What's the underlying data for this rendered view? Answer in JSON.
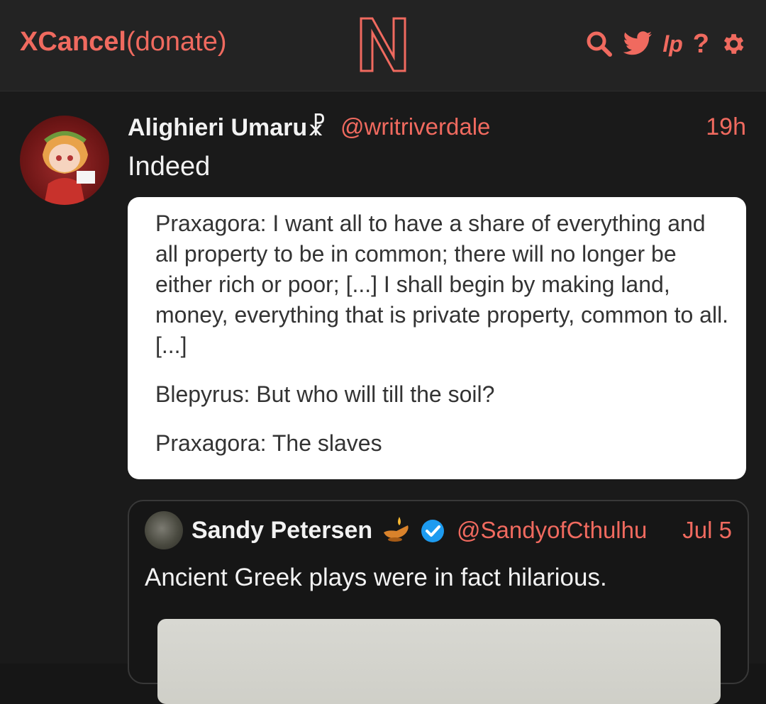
{
  "header": {
    "brand_bold": "XCancel",
    "brand_link": "(donate)",
    "accent_color": "#f06a5f",
    "logo_icon": "n-logo-icon",
    "icons": [
      "search-icon",
      "twitter-bird-icon",
      "liberapay-icon",
      "help-icon",
      "gear-icon"
    ],
    "lp_label": "lp",
    "help_label": "?"
  },
  "tweet": {
    "author_name": "Alighieri Umaru☧",
    "author_handle": "@writriverdale",
    "time": "19h",
    "text": "Indeed",
    "image_quote": {
      "para1": "Praxagora: I want all to have a share of everything and all property to be in common; there will no longer be either rich or poor; [...] I shall begin by making land, money, everything that is private property, common to all. [...]",
      "para2": "Blepyrus: But who will till the soil?",
      "para3": "Praxagora: The slaves"
    },
    "quoted": {
      "author_name": "Sandy Petersen",
      "emoji_icon": "oil-lamp-icon",
      "verified_icon": "verified-badge-icon",
      "author_handle": "@SandyofCthulhu",
      "time": "Jul 5",
      "text": "Ancient Greek plays were in fact hilarious."
    }
  }
}
